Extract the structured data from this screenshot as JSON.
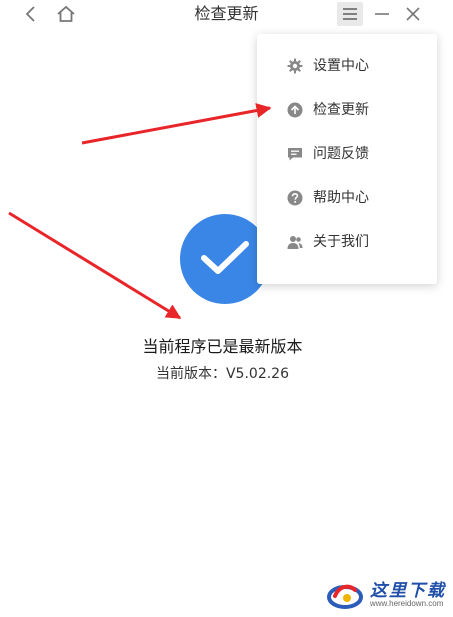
{
  "window": {
    "title": "检查更新"
  },
  "status": {
    "title": "当前程序已是最新版本",
    "version_text": "当前版本：V5.02.26"
  },
  "menu": {
    "items": [
      {
        "label": "设置中心",
        "icon": "gear-icon"
      },
      {
        "label": "检查更新",
        "icon": "upload-arrow-icon"
      },
      {
        "label": "问题反馈",
        "icon": "feedback-message-icon"
      },
      {
        "label": "帮助中心",
        "icon": "help-question-icon"
      },
      {
        "label": "关于我们",
        "icon": "users-icon"
      }
    ]
  },
  "watermark": {
    "text": "这里下载",
    "url": "www.hereidown.com"
  },
  "colors": {
    "accent": "#3a86e6",
    "menu_icon": "#888888",
    "arrow": "#e8262a"
  }
}
